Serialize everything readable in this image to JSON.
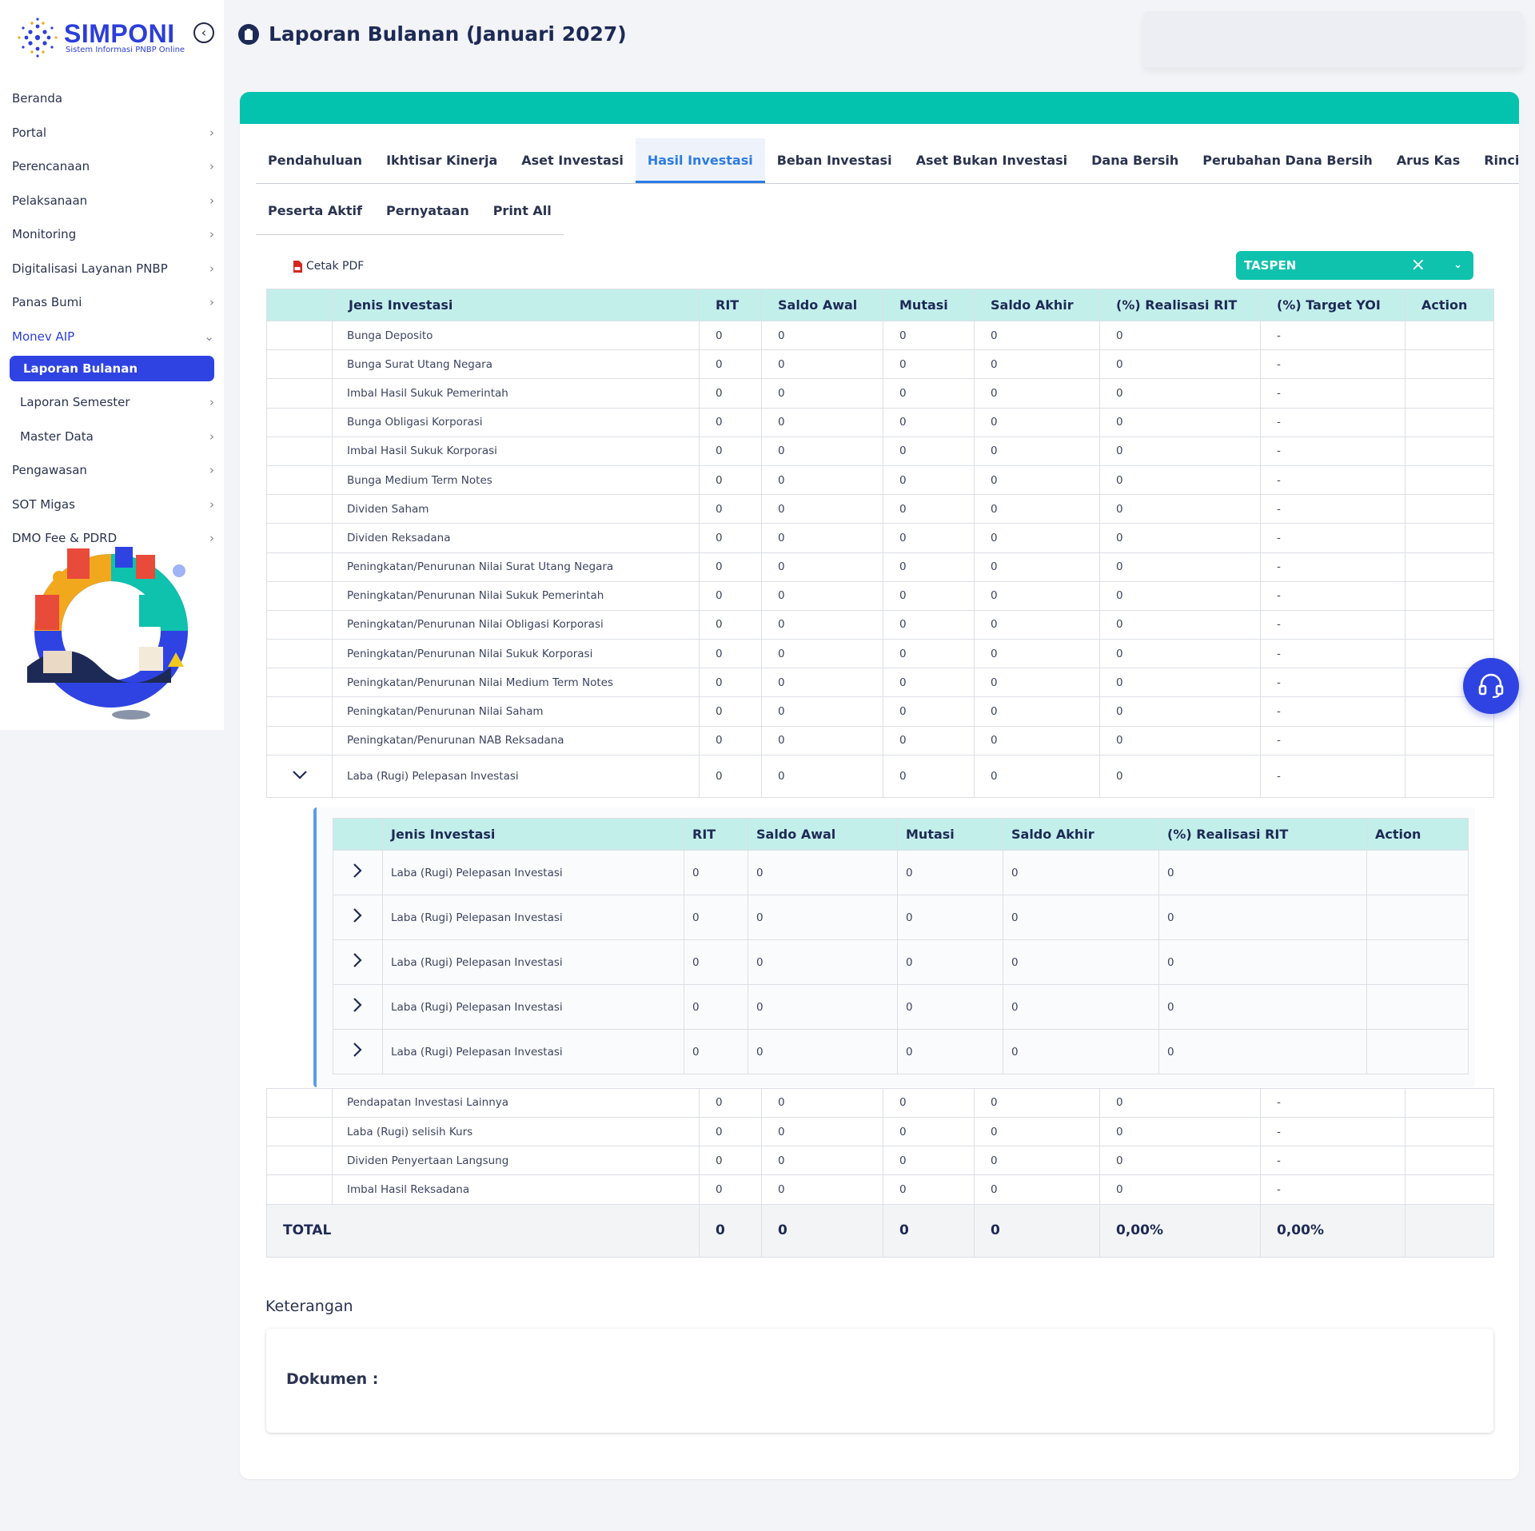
{
  "app": {
    "name": "SIMPONI",
    "tagline": "Sistem Informasi PNBP Online"
  },
  "sidebar": {
    "items": [
      {
        "label": "Beranda"
      },
      {
        "label": "Portal"
      },
      {
        "label": "Perencanaan"
      },
      {
        "label": "Pelaksanaan"
      },
      {
        "label": "Monitoring"
      },
      {
        "label": "Digitalisasi Layanan PNBP"
      },
      {
        "label": "Panas Bumi"
      },
      {
        "label": "Monev AIP"
      },
      {
        "label": "Laporan Bulanan"
      },
      {
        "label": "Laporan Semester"
      },
      {
        "label": "Master Data"
      },
      {
        "label": "Pengawasan"
      },
      {
        "label": "SOT Migas"
      },
      {
        "label": "DMO Fee & PDRD"
      }
    ]
  },
  "page": {
    "title": "Laporan Bulanan (Januari 2027)"
  },
  "tabs": [
    "Pendahuluan",
    "Ikhtisar Kinerja",
    "Aset Investasi",
    "Hasil Investasi",
    "Beban Investasi",
    "Aset Bukan Investasi",
    "Dana Bersih",
    "Perubahan Dana Bersih",
    "Arus Kas",
    "Rincian"
  ],
  "tabs_row2": [
    "Peserta Aktif",
    "Pernyataan",
    "Print All"
  ],
  "active_tab": "Hasil Investasi",
  "toolbar": {
    "cetak_label": "Cetak PDF",
    "select_value": "TASPEN"
  },
  "main_table": {
    "headers": [
      "Jenis Investasi",
      "RIT",
      "Saldo Awal",
      "Mutasi",
      "Saldo Akhir",
      "(%) Realisasi RIT",
      "(%) Target YOI",
      "Action"
    ],
    "rows": [
      [
        "Bunga Deposito",
        "0",
        "0",
        "0",
        "0",
        "0",
        "-"
      ],
      [
        "Bunga Surat Utang Negara",
        "0",
        "0",
        "0",
        "0",
        "0",
        "-"
      ],
      [
        "Imbal Hasil Sukuk Pemerintah",
        "0",
        "0",
        "0",
        "0",
        "0",
        "-"
      ],
      [
        "Bunga Obligasi Korporasi",
        "0",
        "0",
        "0",
        "0",
        "0",
        "-"
      ],
      [
        "Imbal Hasil Sukuk Korporasi",
        "0",
        "0",
        "0",
        "0",
        "0",
        "-"
      ],
      [
        "Bunga Medium Term Notes",
        "0",
        "0",
        "0",
        "0",
        "0",
        "-"
      ],
      [
        "Dividen Saham",
        "0",
        "0",
        "0",
        "0",
        "0",
        "-"
      ],
      [
        "Dividen Reksadana",
        "0",
        "0",
        "0",
        "0",
        "0",
        "-"
      ],
      [
        "Peningkatan/Penurunan Nilai Surat Utang Negara",
        "0",
        "0",
        "0",
        "0",
        "0",
        "-"
      ],
      [
        "Peningkatan/Penurunan Nilai Sukuk Pemerintah",
        "0",
        "0",
        "0",
        "0",
        "0",
        "-"
      ],
      [
        "Peningkatan/Penurunan Nilai Obligasi Korporasi",
        "0",
        "0",
        "0",
        "0",
        "0",
        "-"
      ],
      [
        "Peningkatan/Penurunan Nilai Sukuk Korporasi",
        "0",
        "0",
        "0",
        "0",
        "0",
        "-"
      ],
      [
        "Peningkatan/Penurunan Nilai Medium Term Notes",
        "0",
        "0",
        "0",
        "0",
        "0",
        "-"
      ],
      [
        "Peningkatan/Penurunan Nilai Saham",
        "0",
        "0",
        "0",
        "0",
        "0",
        "-"
      ],
      [
        "Peningkatan/Penurunan NAB Reksadana",
        "0",
        "0",
        "0",
        "0",
        "0",
        "-"
      ]
    ],
    "expanded_row": [
      "Laba (Rugi) Pelepasan Investasi",
      "0",
      "0",
      "0",
      "0",
      "0",
      "-"
    ],
    "rows_after": [
      [
        "Pendapatan Investasi Lainnya",
        "0",
        "0",
        "0",
        "0",
        "0",
        "-"
      ],
      [
        "Laba (Rugi) selisih Kurs",
        "0",
        "0",
        "0",
        "0",
        "0",
        "-"
      ],
      [
        "Dividen Penyertaan Langsung",
        "0",
        "0",
        "0",
        "0",
        "0",
        "-"
      ],
      [
        "Imbal Hasil Reksadana",
        "0",
        "0",
        "0",
        "0",
        "0",
        "-"
      ]
    ],
    "total": [
      "TOTAL",
      "0",
      "0",
      "0",
      "0",
      "0,00%",
      "0,00%"
    ]
  },
  "sub_table": {
    "headers": [
      "Jenis Investasi",
      "RIT",
      "Saldo Awal",
      "Mutasi",
      "Saldo Akhir",
      "(%) Realisasi RIT",
      "Action"
    ],
    "rows": [
      [
        "Laba (Rugi) Pelepasan Investasi",
        "0",
        "0",
        "0",
        "0",
        "0"
      ],
      [
        "Laba (Rugi) Pelepasan Investasi",
        "0",
        "0",
        "0",
        "0",
        "0"
      ],
      [
        "Laba (Rugi) Pelepasan Investasi",
        "0",
        "0",
        "0",
        "0",
        "0"
      ],
      [
        "Laba (Rugi) Pelepasan Investasi",
        "0",
        "0",
        "0",
        "0",
        "0"
      ],
      [
        "Laba (Rugi) Pelepasan Investasi",
        "0",
        "0",
        "0",
        "0",
        "0"
      ]
    ]
  },
  "keterangan": {
    "title": "Keterangan",
    "dokumen_label": "Dokumen :"
  }
}
